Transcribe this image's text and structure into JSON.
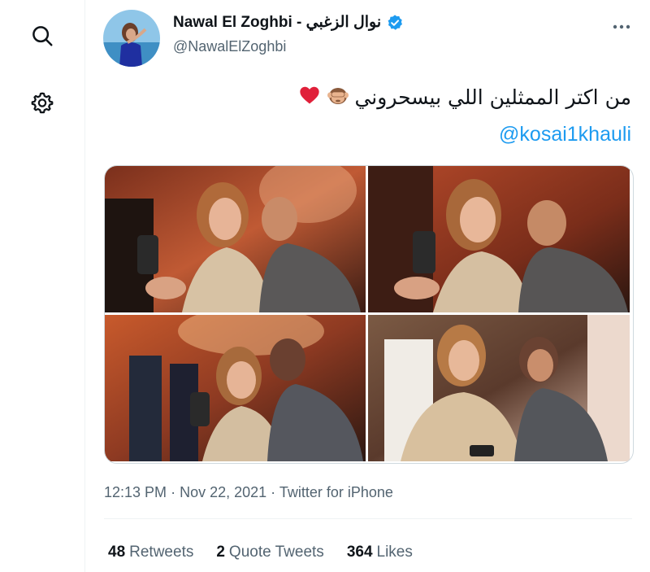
{
  "nav": {
    "search_icon": "search-icon",
    "settings_icon": "gear-icon"
  },
  "tweet": {
    "author": {
      "display_name": "Nawal El Zoghbi - نوال الزغبي",
      "handle": "@NawalElZoghbi",
      "verified": true
    },
    "text": "من اكتر الممثلين اللي بيسحروني",
    "emojis": [
      "see-no-evil-monkey-icon",
      "red-heart-icon"
    ],
    "mention": "@kosai1khauli",
    "photos": [
      {
        "id": "photo-1",
        "alt": ""
      },
      {
        "id": "photo-2",
        "alt": ""
      },
      {
        "id": "photo-3",
        "alt": ""
      },
      {
        "id": "photo-4",
        "alt": ""
      }
    ],
    "meta": {
      "time": "12:13 PM",
      "date": "Nov 22, 2021",
      "source": "Twitter for iPhone",
      "separator": "·"
    },
    "stats": {
      "retweets_count": "48",
      "retweets_label": "Retweets",
      "quotes_count": "2",
      "quotes_label": "Quote Tweets",
      "likes_count": "364",
      "likes_label": "Likes"
    }
  },
  "colors": {
    "accent": "#1d9bf0",
    "text_primary": "#0f1419",
    "text_secondary": "#536471",
    "border": "#eff3f4",
    "heart": "#f91880"
  }
}
